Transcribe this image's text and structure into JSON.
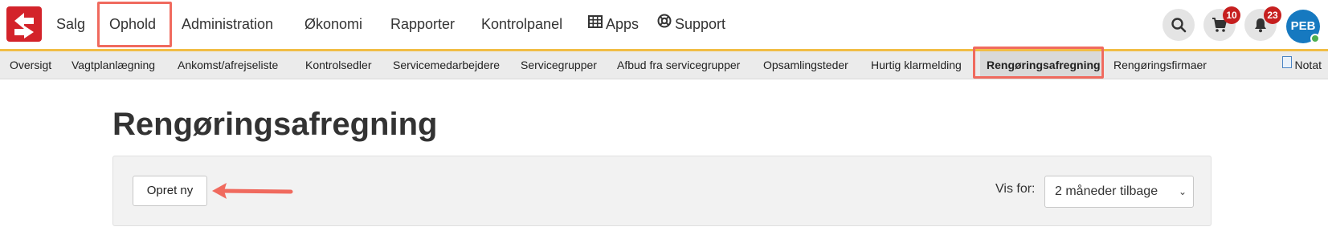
{
  "nav": {
    "items": [
      "Salg",
      "Ophold",
      "Administration",
      "Økonomi",
      "Rapporter",
      "Kontrolpanel",
      "Apps",
      "Support"
    ],
    "cart_count": "10",
    "notification_count": "23",
    "avatar_initials": "PEB"
  },
  "subnav": {
    "items": [
      "Oversigt",
      "Vagtplanlægning",
      "Ankomst/afrejseliste",
      "Kontrolsedler",
      "Servicemedarbejdere",
      "Servicegrupper",
      "Afbud fra servicegrupper",
      "Opsamlingsteder",
      "Hurtig klarmelding",
      "Rengøringsafregning",
      "Rengøringsfirmaer"
    ],
    "active": "Rengøringsafregning",
    "notat_label": "Notat"
  },
  "main": {
    "title": "Rengøringsafregning",
    "create_button": "Opret ny",
    "vis_for_label": "Vis for:",
    "period_select": "2 måneder tilbage"
  },
  "colors": {
    "brand": "#d3232a",
    "accent_line": "#f1bd45",
    "highlight": "#f06a5e",
    "avatar": "#1679c0"
  }
}
